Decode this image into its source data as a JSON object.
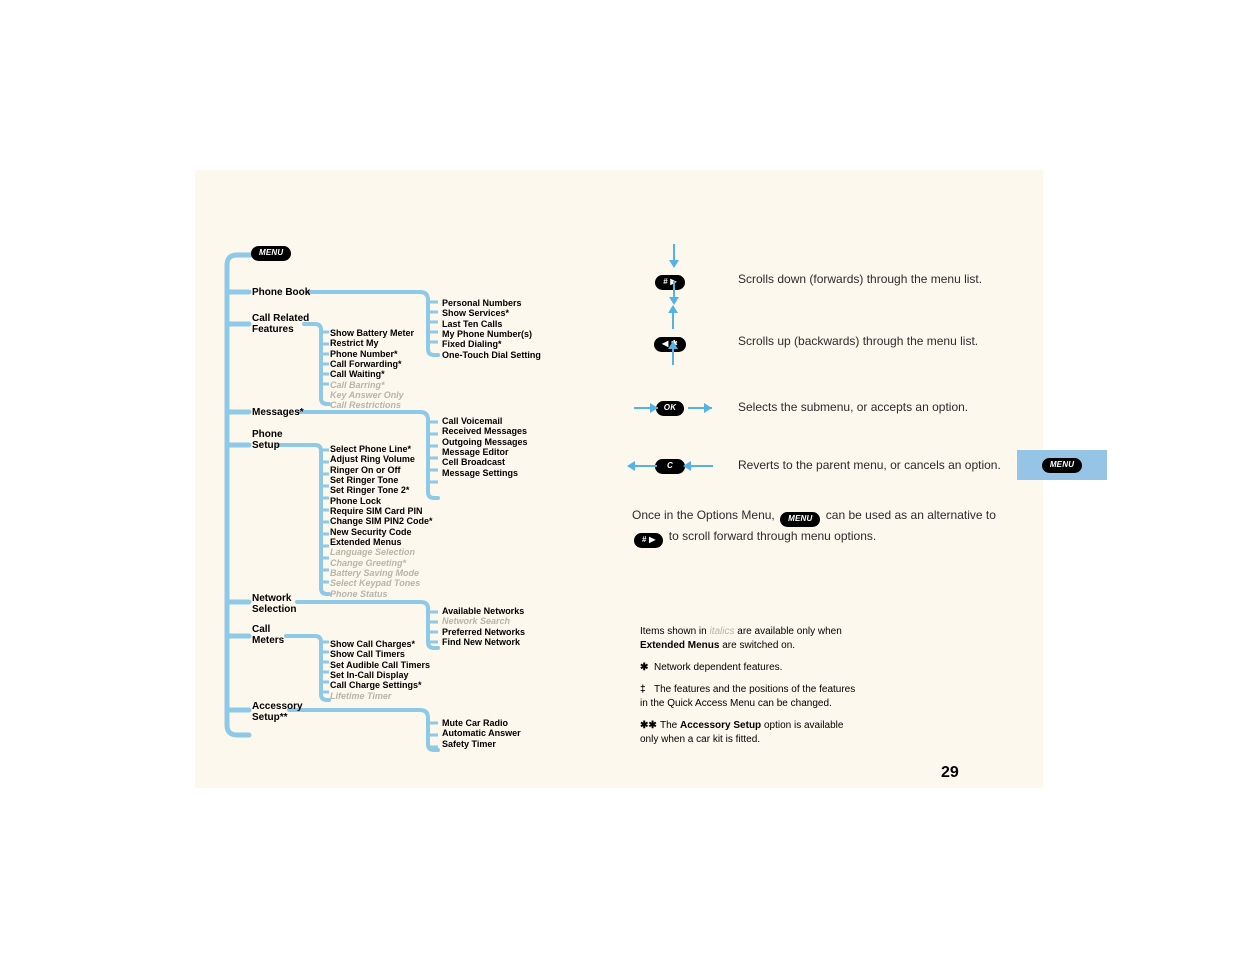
{
  "page_number": "29",
  "menu_button": "MENU",
  "tree": {
    "phone_book": {
      "label": "Phone Book",
      "sub": [
        "Personal Numbers",
        "Show Services*",
        "Last Ten Calls",
        "My Phone Number(s)",
        "Fixed Dialing*",
        "One-Touch Dial Setting"
      ]
    },
    "call_related": {
      "label1": "Call Related",
      "label2": "Features",
      "sub": [
        "Show Battery Meter",
        "Restrict My",
        "Phone Number*",
        "Call Forwarding*",
        "Call Waiting*"
      ],
      "ext": [
        "Call Barring*",
        "Key Answer Only",
        "Call Restrictions"
      ]
    },
    "messages": {
      "label": "Messages*",
      "sub": [
        "Call Voicemail",
        "Received Messages",
        "Outgoing Messages",
        "Message Editor",
        "Cell Broadcast",
        "Message Settings"
      ]
    },
    "phone_setup": {
      "label1": "Phone",
      "label2": "Setup",
      "sub": [
        "Select Phone Line*",
        "Adjust Ring Volume",
        "Ringer On or Off",
        "Set Ringer Tone",
        "Set Ringer Tone 2*",
        "Phone Lock",
        "Require SIM Card PIN",
        "Change SIM PIN2 Code*",
        "New Security Code",
        "Extended Menus"
      ],
      "ext": [
        "Language Selection",
        "Change Greeting*",
        "Battery Saving Mode",
        "Select Keypad Tones",
        "Phone Status"
      ]
    },
    "network": {
      "label1": "Network",
      "label2": "Selection",
      "sub": [
        "Available Networks"
      ],
      "ext": [
        "Network Search"
      ],
      "sub2": [
        "Preferred Networks",
        "Find New Network"
      ]
    },
    "call_meters": {
      "label1": "Call",
      "label2": "Meters",
      "sub": [
        "Show Call Charges*",
        "Show Call Timers",
        "Set Audible Call Timers",
        "Set In-Call Display",
        "Call Charge Settings*"
      ],
      "ext": [
        "Lifetime Timer"
      ]
    },
    "accessory": {
      "label1": "Accessory",
      "label2": "Setup**",
      "sub": [
        "Mute Car Radio",
        "Automatic Answer",
        "Safety Timer"
      ]
    }
  },
  "nav": {
    "hash": {
      "key": "# ▶",
      "desc": "Scrolls down (forwards) through the menu list."
    },
    "star": {
      "key": "◀ ✱",
      "desc": "Scrolls up (backwards) through the menu list."
    },
    "ok": {
      "key": "OK",
      "desc": "Selects the submenu, or accepts an option."
    },
    "c": {
      "key": "C",
      "desc": "Reverts to the parent menu, or cancels an option."
    }
  },
  "paragraph": {
    "p1": "Once in the Options Menu, ",
    "key1": "MENU",
    "p2": " can be used as an alternative to ",
    "key2": "# ▶",
    "p3": " to scroll forward through menu options."
  },
  "legend": {
    "l1a": "Items shown in ",
    "l1b": "italics",
    "l1c": " are available only when ",
    "l1d": "Extended Menus",
    "l1e": " are switched on.",
    "l2": "Network dependent features.",
    "l3": "The features and the positions of the features in the Quick Access Menu can be changed.",
    "l4a": "The ",
    "l4b": "Accessory Setup",
    "l4c": " option is available only when a car kit is fitted.",
    "sym_star": "✱",
    "sym_dagger": "‡",
    "sym_dstar": "✱✱"
  },
  "side_tab": "MENU"
}
